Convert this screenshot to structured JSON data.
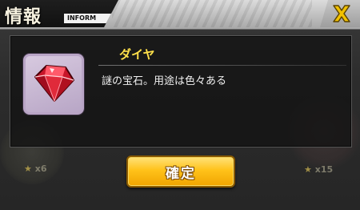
{
  "header": {
    "title": "情報",
    "subtitle": "INFORM",
    "close_icon": "close-x-icon"
  },
  "item": {
    "icon": "red-gem-icon",
    "name": "ダイヤ",
    "description": "謎の宝石。用途は色々ある"
  },
  "background": {
    "left_count": "x6",
    "right_count": "x15",
    "star_icon": "star-icon"
  },
  "actions": {
    "confirm_label": "確定"
  },
  "colors": {
    "item_name": "#ffe04a",
    "confirm_button": "#ffc21a",
    "close_icon": "#f2c200",
    "gem": "#d8202e"
  }
}
